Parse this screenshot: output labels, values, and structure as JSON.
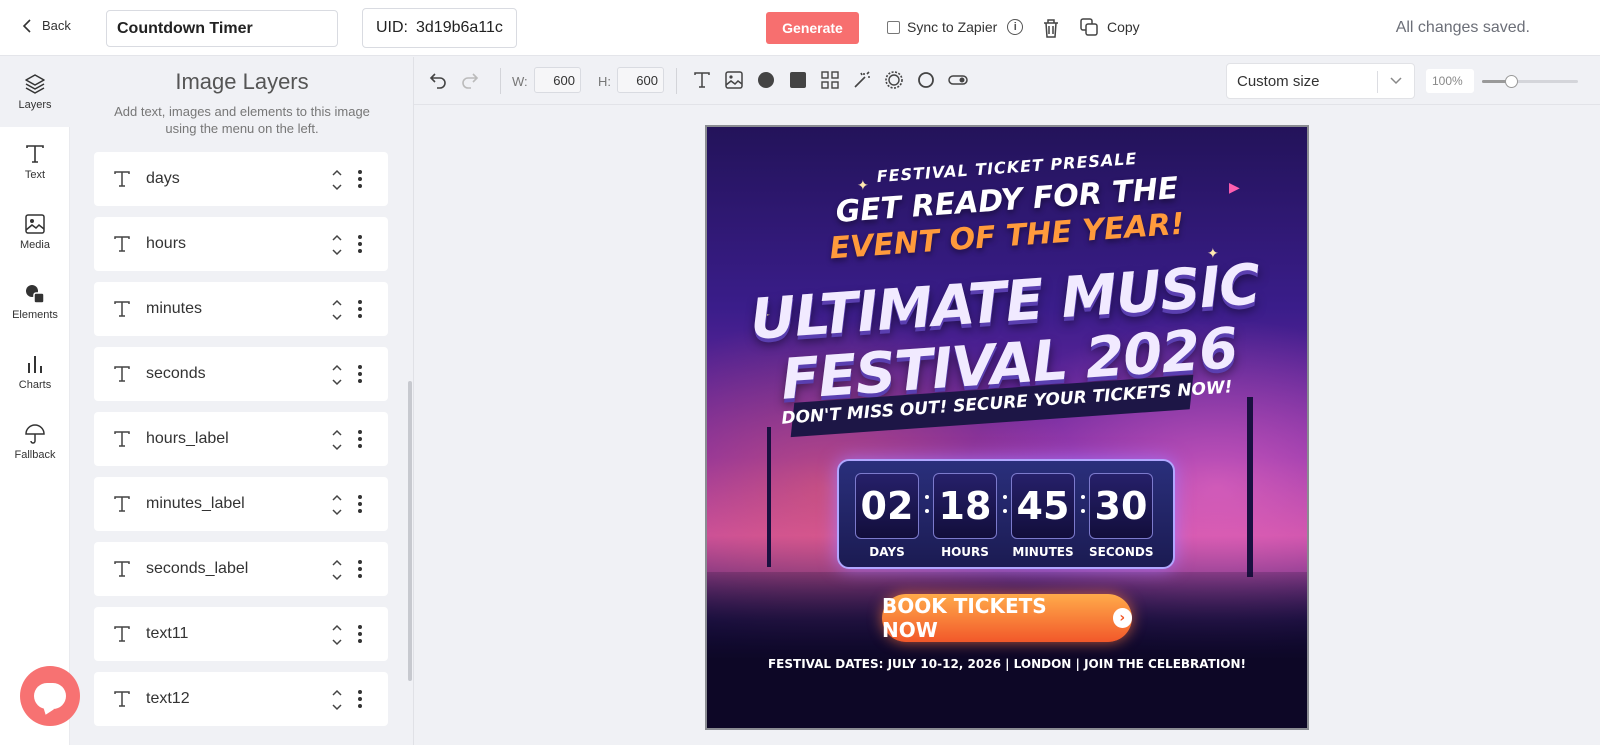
{
  "topbar": {
    "back_label": "Back",
    "template_name": "Countdown Timer",
    "uid_label": "UID:",
    "uid_value": "3d19b6a11c",
    "generate_label": "Generate",
    "sync_label": "Sync to Zapier",
    "sync_checked": false,
    "copy_label": "Copy",
    "status": "All changes saved."
  },
  "rail": {
    "items": [
      {
        "label": "Layers",
        "icon": "layers-icon"
      },
      {
        "label": "Text",
        "icon": "text-icon"
      },
      {
        "label": "Media",
        "icon": "image-icon"
      },
      {
        "label": "Elements",
        "icon": "shapes-icon"
      },
      {
        "label": "Charts",
        "icon": "bar-chart-icon"
      },
      {
        "label": "Fallback",
        "icon": "umbrella-icon"
      }
    ]
  },
  "panel": {
    "title": "Image Layers",
    "subtitle": "Add text, images and elements to this image using the menu on the left.",
    "layers": [
      {
        "name": "days"
      },
      {
        "name": "hours"
      },
      {
        "name": "minutes"
      },
      {
        "name": "seconds"
      },
      {
        "name": "hours_label"
      },
      {
        "name": "minutes_label"
      },
      {
        "name": "seconds_label"
      },
      {
        "name": "text11"
      },
      {
        "name": "text12"
      }
    ]
  },
  "toolbar": {
    "width_label": "W:",
    "width_value": "600",
    "height_label": "H:",
    "height_value": "600",
    "size_preset": "Custom size",
    "zoom_text": "100%",
    "zoom_fraction": 0.3
  },
  "canvas": {
    "presale": "FESTIVAL TICKET PRESALE",
    "headline_1": "GET READY FOR THE",
    "headline_2": "EVENT OF THE YEAR!",
    "title_1": "ULTIMATE MUSIC",
    "title_2": "FESTIVAL 2026",
    "tagline": "DON'T MISS OUT! SECURE YOUR TICKETS NOW!",
    "countdown": [
      {
        "value": "02",
        "label": "DAYS"
      },
      {
        "value": "18",
        "label": "HOURS"
      },
      {
        "value": "45",
        "label": "MINUTES"
      },
      {
        "value": "30",
        "label": "SECONDS"
      }
    ],
    "cta": "BOOK TICKETS NOW",
    "footer": "FESTIVAL DATES: JULY 10-12, 2026  |  LONDON  |  JOIN THE CELEBRATION!"
  }
}
